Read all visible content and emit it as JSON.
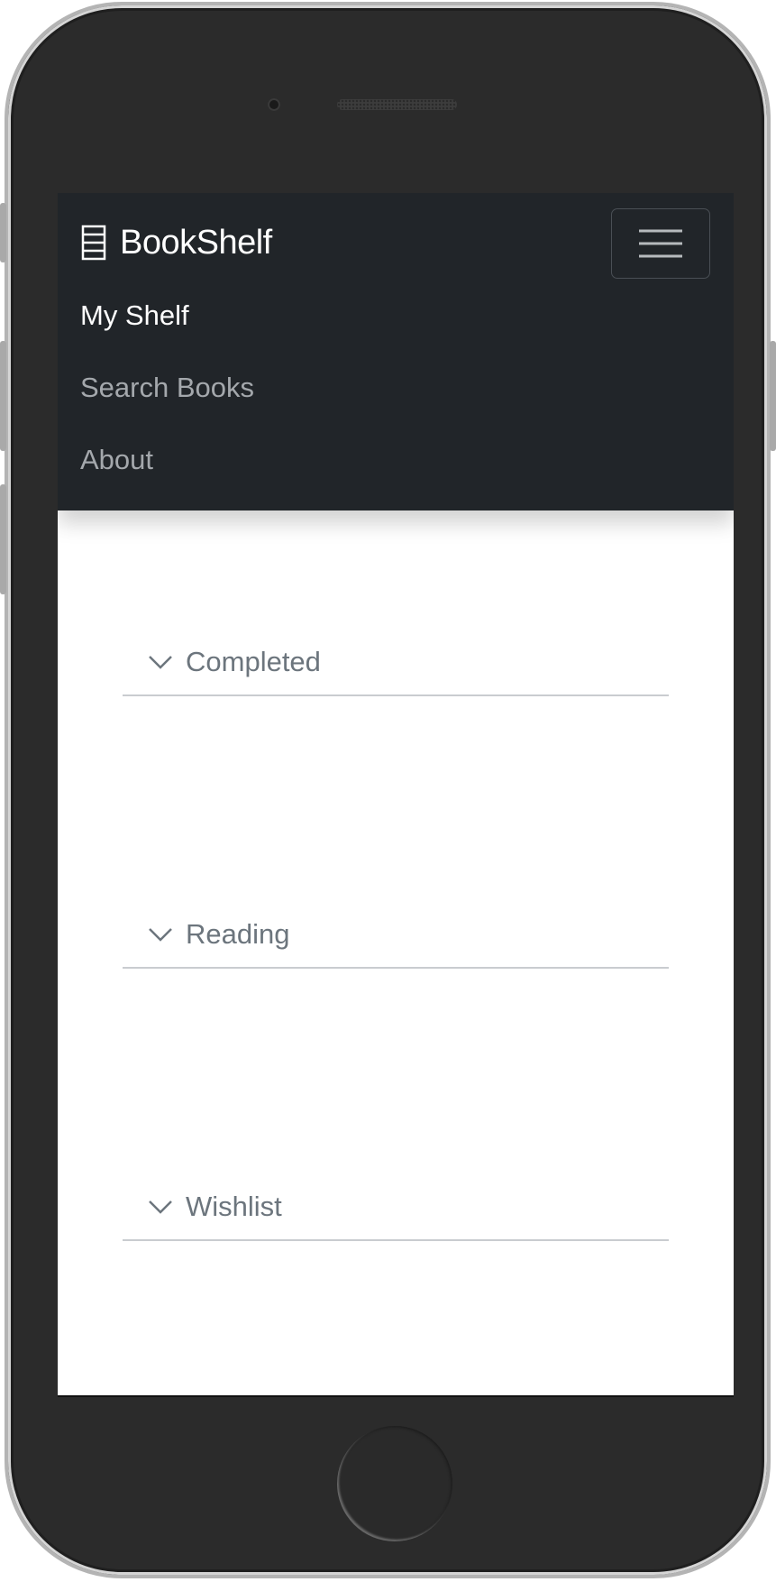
{
  "app": {
    "brand_name": "BookShelf",
    "brand_icon": "bookshelf-icon"
  },
  "nav": {
    "toggler_icon": "hamburger-icon",
    "items": [
      {
        "label": "My Shelf",
        "active": true
      },
      {
        "label": "Search Books",
        "active": false
      },
      {
        "label": "About",
        "active": false
      }
    ]
  },
  "shelves": [
    {
      "label": "Completed",
      "icon": "chevron-down-icon"
    },
    {
      "label": "Reading",
      "icon": "chevron-down-icon"
    },
    {
      "label": "Wishlist",
      "icon": "chevron-down-icon"
    }
  ],
  "colors": {
    "navbar_bg": "#212529",
    "nav_active": "#ffffff",
    "nav_inactive": "#a4a8ac",
    "section_text": "#6c757d"
  }
}
